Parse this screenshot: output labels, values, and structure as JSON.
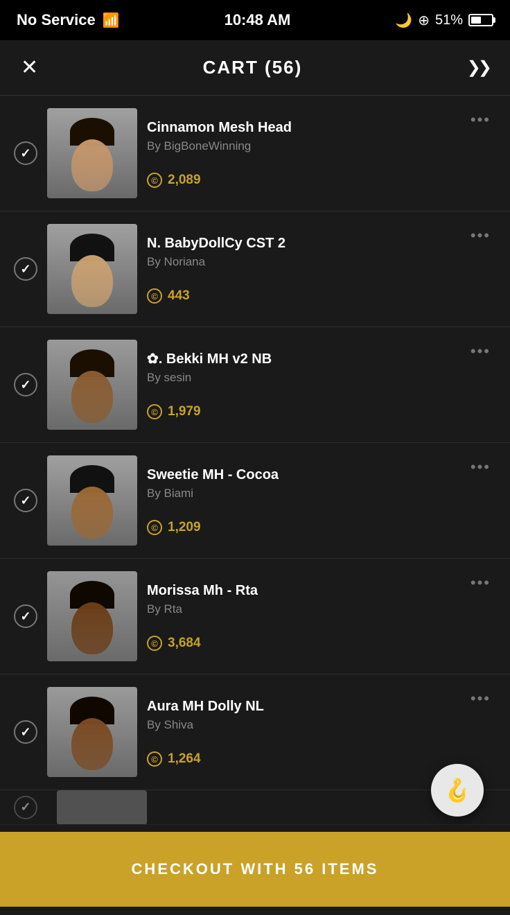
{
  "statusBar": {
    "carrier": "No Service",
    "time": "10:48 AM",
    "battery": "51%"
  },
  "header": {
    "title": "CART (56)",
    "closeLabel": "✕",
    "chevronLabel": "❯❯"
  },
  "cart": {
    "items": [
      {
        "id": 1,
        "name": "Cinnamon Mesh Head",
        "creator": "By BigBoneWinning",
        "price": "2,089",
        "checked": true,
        "skinTone": "#c4956a"
      },
      {
        "id": 2,
        "name": "N. BabyDollCy CST 2",
        "creator": "By Noriana",
        "price": "443",
        "checked": true,
        "skinTone": "#c9a070"
      },
      {
        "id": 3,
        "name": "✿. Bekki MH v2 NB",
        "creator": "By sesin",
        "price": "1,979",
        "checked": true,
        "skinTone": "#8a5c30"
      },
      {
        "id": 4,
        "name": "Sweetie MH - Cocoa",
        "creator": "By Biami",
        "price": "1,209",
        "checked": true,
        "skinTone": "#9a6835"
      },
      {
        "id": 5,
        "name": "Morissa Mh - Rta",
        "creator": "By Rta",
        "price": "3,684",
        "checked": true,
        "skinTone": "#6b3d18"
      },
      {
        "id": 6,
        "name": "Aura MH Dolly NL",
        "creator": "By Shiva",
        "price": "1,264",
        "checked": true,
        "skinTone": "#7a4a22"
      }
    ],
    "checkoutLabel": "CHECKOUT WITH 56 ITEMS"
  },
  "icons": {
    "coin": "©",
    "more": "•••",
    "hanger": "🪝",
    "check": "✓"
  }
}
